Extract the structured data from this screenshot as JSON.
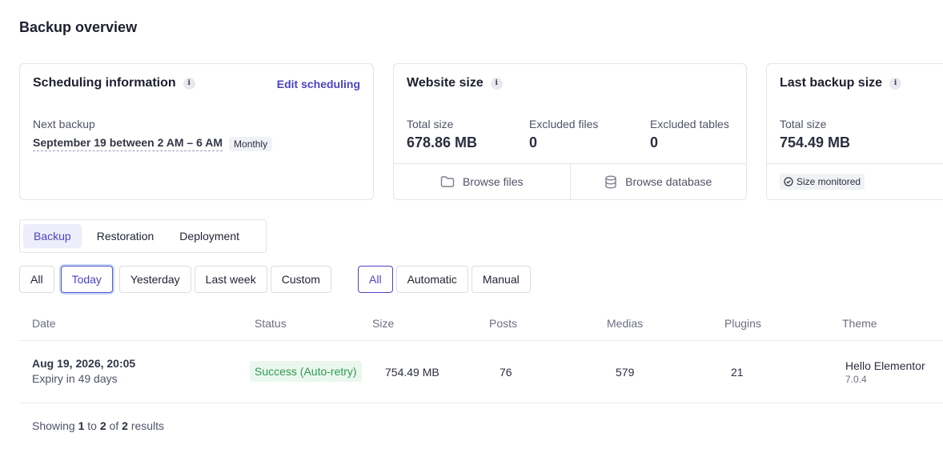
{
  "page": {
    "title": "Backup overview"
  },
  "scheduling": {
    "title": "Scheduling information",
    "edit_label": "Edit scheduling",
    "next_label": "Next backup",
    "next_value": "September 19 between 2 AM – 6 AM",
    "frequency": "Monthly"
  },
  "website_size": {
    "title": "Website size",
    "total_label": "Total size",
    "total_value": "678.86 MB",
    "excluded_files_label": "Excluded files",
    "excluded_files_value": "0",
    "excluded_tables_label": "Excluded tables",
    "excluded_tables_value": "0",
    "browse_files": "Browse files",
    "browse_database": "Browse database"
  },
  "last_backup": {
    "title": "Last backup size",
    "total_label": "Total size",
    "total_value": "754.49 MB",
    "monitor_badge": "Size monitored"
  },
  "tabs": [
    "Backup",
    "Restoration",
    "Deployment"
  ],
  "active_tab": "Backup",
  "date_filters": [
    "All",
    "Today",
    "Yesterday",
    "Last week",
    "Custom"
  ],
  "active_date_filter": "Today",
  "type_filters": [
    "All",
    "Automatic",
    "Manual"
  ],
  "active_type_filter": "All",
  "table": {
    "headers": [
      "Date",
      "Status",
      "Size",
      "Posts",
      "Medias",
      "Plugins",
      "Theme"
    ],
    "rows": [
      {
        "date": "Aug 19, 2026, 20:05",
        "expiry": "Expiry in 49 days",
        "status": "Success (Auto-retry)",
        "size": "754.49 MB",
        "posts": "76",
        "medias": "579",
        "plugins": "21",
        "theme": "Hello Elementor",
        "theme_version": "7.0.4"
      }
    ]
  },
  "pagination": {
    "prefix": "Showing",
    "from": "1",
    "to_word": "to",
    "to": "2",
    "of_word": "of",
    "total": "2",
    "suffix": "results"
  },
  "colors": {
    "accent": "#4b43c4",
    "success_text": "#2f9a4f",
    "success_bg": "#eaf7ee",
    "border": "#e3e4ea"
  },
  "icons": {
    "info": "info-icon",
    "folder": "folder-icon",
    "database": "database-icon",
    "check_circle": "check-circle-icon"
  }
}
